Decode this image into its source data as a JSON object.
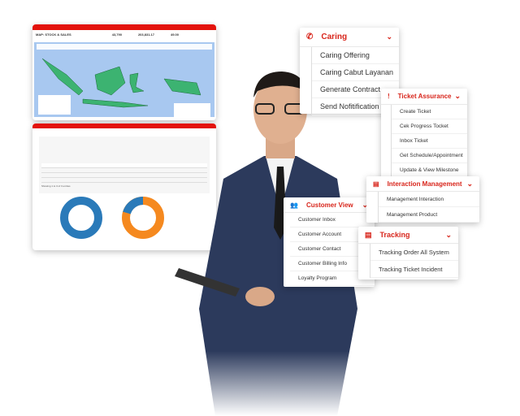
{
  "dashboard_map": {
    "title": "MAP: STOCK & SALES",
    "stats": [
      "43,790",
      "203,831.17",
      "49.00"
    ]
  },
  "dashboard_table": {
    "showing": "Showing 1 to 3 of 3 entries"
  },
  "caring": {
    "title": "Caring",
    "items": [
      "Caring Offering",
      "Caring Cabut Layanan",
      "Generate Contract",
      "Send Nofitification"
    ]
  },
  "ticket_assurance": {
    "title": "Ticket Assurance",
    "items": [
      "Create Ticket",
      "Cek Progress Tocket",
      "Inbox Ticket",
      "Get Schedule/Appointment",
      "Update & View Milestone"
    ]
  },
  "interaction_management": {
    "title": "Interaction Management",
    "items": [
      "Management Interaction",
      "Management Product"
    ]
  },
  "customer_view": {
    "title": "Customer View",
    "items": [
      "Customer Inbox",
      "Customer Account",
      "Customer Contact",
      "Customer Billing Info",
      "Loyalty Program"
    ]
  },
  "tracking": {
    "title": "Tracking",
    "items": [
      "Tracking Order All System",
      "Tracking Ticket Incident"
    ]
  },
  "colors": {
    "accent": "#d8261c",
    "map_sea": "#a8c8f0",
    "map_land": "#3cb371",
    "donut_blue": "#2a7ab9",
    "donut_orange": "#f5891f"
  }
}
